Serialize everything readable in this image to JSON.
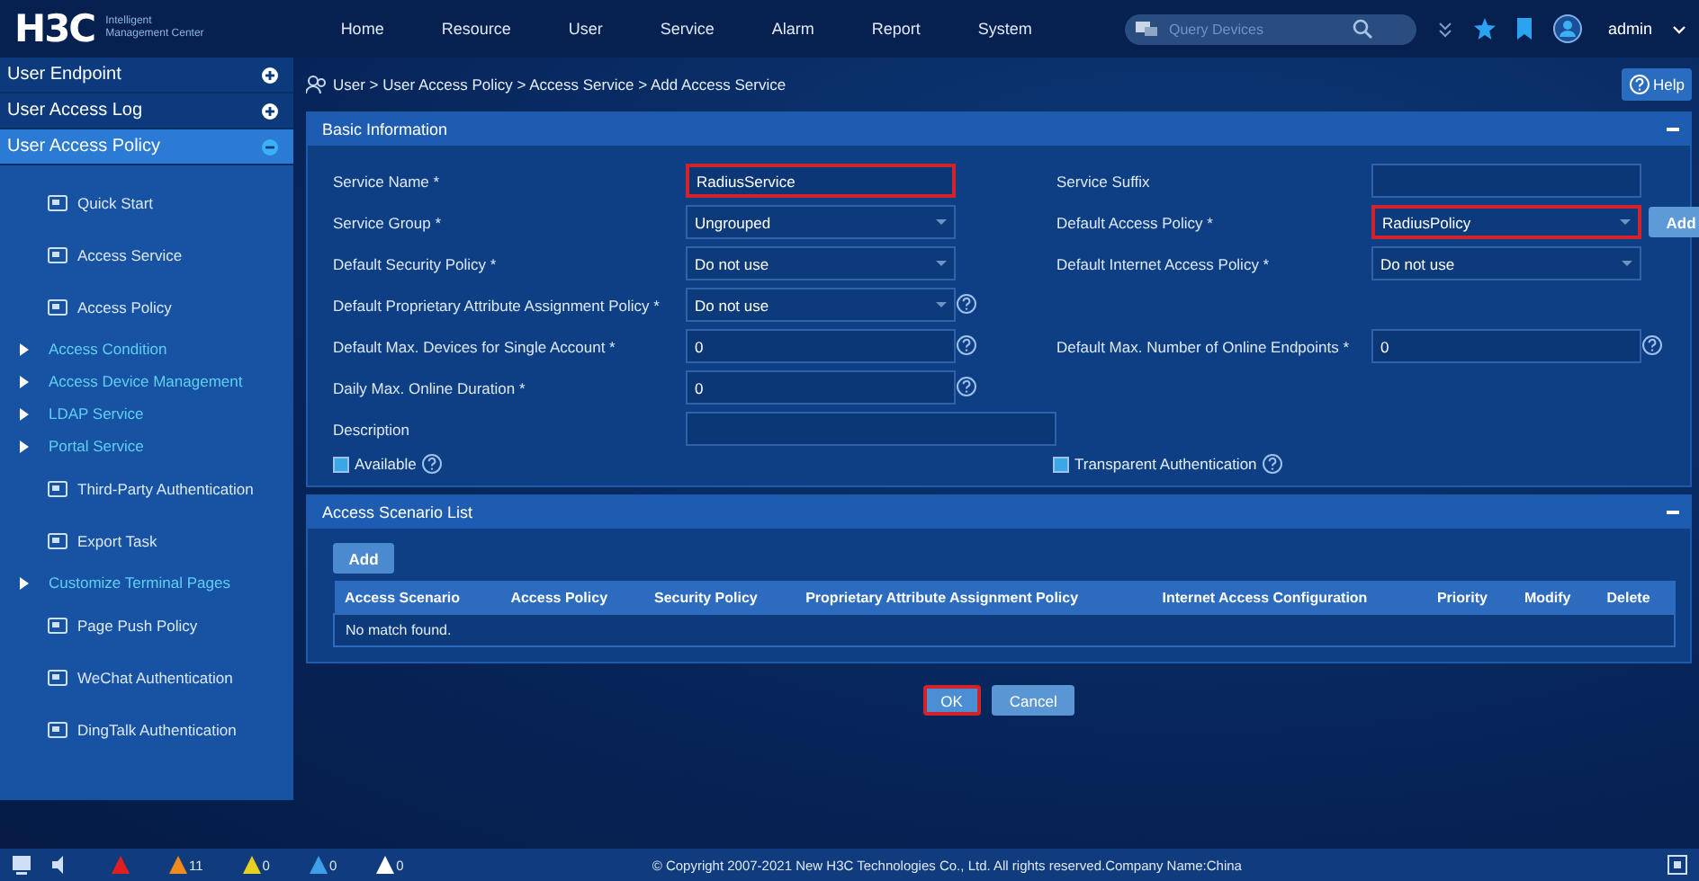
{
  "header": {
    "logo": "H3C",
    "product_line1": "Intelligent",
    "product_line2": "Management Center",
    "nav": [
      {
        "label": "Home"
      },
      {
        "label": "Resource"
      },
      {
        "label": "User"
      },
      {
        "label": "Service"
      },
      {
        "label": "Alarm"
      },
      {
        "label": "Report"
      },
      {
        "label": "System"
      }
    ],
    "search": {
      "placeholder": "Query Devices"
    },
    "user": "admin"
  },
  "sidebar": {
    "sections": [
      {
        "label": "User Endpoint",
        "expanded": false,
        "selected": false
      },
      {
        "label": "User Access Log",
        "expanded": false,
        "selected": false
      },
      {
        "label": "User Access Policy",
        "expanded": true,
        "selected": true
      }
    ],
    "items": [
      {
        "label": "Quick Start",
        "kind": "icon"
      },
      {
        "label": "Access Service",
        "kind": "icon"
      },
      {
        "label": "Access Policy",
        "kind": "icon"
      },
      {
        "label": "Access Condition",
        "kind": "group"
      },
      {
        "label": "Access Device Management",
        "kind": "group"
      },
      {
        "label": "LDAP Service",
        "kind": "group"
      },
      {
        "label": "Portal Service",
        "kind": "group"
      },
      {
        "label": "Third-Party Authentication",
        "kind": "icon"
      },
      {
        "label": "Export Task",
        "kind": "icon"
      },
      {
        "label": "Customize Terminal Pages",
        "kind": "group"
      },
      {
        "label": "Page Push Policy",
        "kind": "icon"
      },
      {
        "label": "WeChat Authentication",
        "kind": "icon"
      },
      {
        "label": "DingTalk Authentication",
        "kind": "icon"
      }
    ]
  },
  "breadcrumb": "User > User Access Policy > Access Service > Add Access Service",
  "help_button": "Help",
  "basic_info": {
    "title": "Basic Information",
    "rows": [
      {
        "left": {
          "label": "Service Name *",
          "kind": "text",
          "value": "RadiusService",
          "highlighted": true,
          "help": false
        },
        "right": {
          "label": "Service Suffix",
          "kind": "text",
          "highlighted": false,
          "help": false
        }
      },
      {
        "left": {
          "label": "Service Group *",
          "kind": "select",
          "value": "Ungrouped",
          "highlighted": false,
          "help": false
        },
        "right": {
          "label": "Default Access Policy *",
          "kind": "select",
          "value": "RadiusPolicy",
          "highlighted": true,
          "help": false,
          "button": "Add"
        }
      },
      {
        "left": {
          "label": "Default Security Policy *",
          "kind": "select",
          "value": "Do not use",
          "highlighted": false,
          "help": false
        },
        "right": {
          "label": "Default Internet Access Policy *",
          "kind": "select",
          "value": "Do not use",
          "highlighted": false,
          "help": false
        }
      },
      {
        "left": {
          "label": "Default Proprietary Attribute Assignment Policy *",
          "kind": "select",
          "value": "Do not use",
          "highlighted": false,
          "help": true
        }
      },
      {
        "left": {
          "label": "Default Max. Devices for Single Account *",
          "kind": "text",
          "value": "0",
          "highlighted": false,
          "help": true
        },
        "right": {
          "label": "Default Max. Number of Online Endpoints *",
          "kind": "text",
          "value": "0",
          "highlighted": false,
          "help": true
        }
      },
      {
        "left": {
          "label": "Daily Max. Online Duration *",
          "kind": "text",
          "value": "0",
          "highlighted": false,
          "help": true
        }
      },
      {
        "left": {
          "label": "Description",
          "kind": "wide_text",
          "highlighted": false,
          "help": false
        }
      }
    ],
    "checkboxes": [
      {
        "label": "Available",
        "checked": true,
        "help": true
      },
      {
        "label": "Transparent Authentication",
        "checked": true,
        "help": true
      }
    ]
  },
  "scenario_list": {
    "title": "Access Scenario List",
    "add_button": "Add",
    "columns": [
      "Access Scenario",
      "Access Policy",
      "Security Policy",
      "Proprietary Attribute Assignment Policy",
      "Internet Access Configuration",
      "Priority",
      "Modify",
      "Delete"
    ],
    "empty_message": "No match found."
  },
  "actions": [
    {
      "label": "OK",
      "highlighted": true
    },
    {
      "label": "Cancel",
      "highlighted": false
    }
  ],
  "status_bar": {
    "alarms": [
      {
        "color": "#e02020"
      },
      {
        "color": "#f08a1c",
        "count": "11"
      },
      {
        "color": "#e8d020",
        "count": "0"
      },
      {
        "color": "#3fa0ea",
        "count": "0"
      },
      {
        "color": "#ffffff",
        "count": "0"
      }
    ],
    "copyright": "© Copyright 2007-2021 New H3C Technologies Co., Ltd. All rights reserved.Company Name:China"
  }
}
